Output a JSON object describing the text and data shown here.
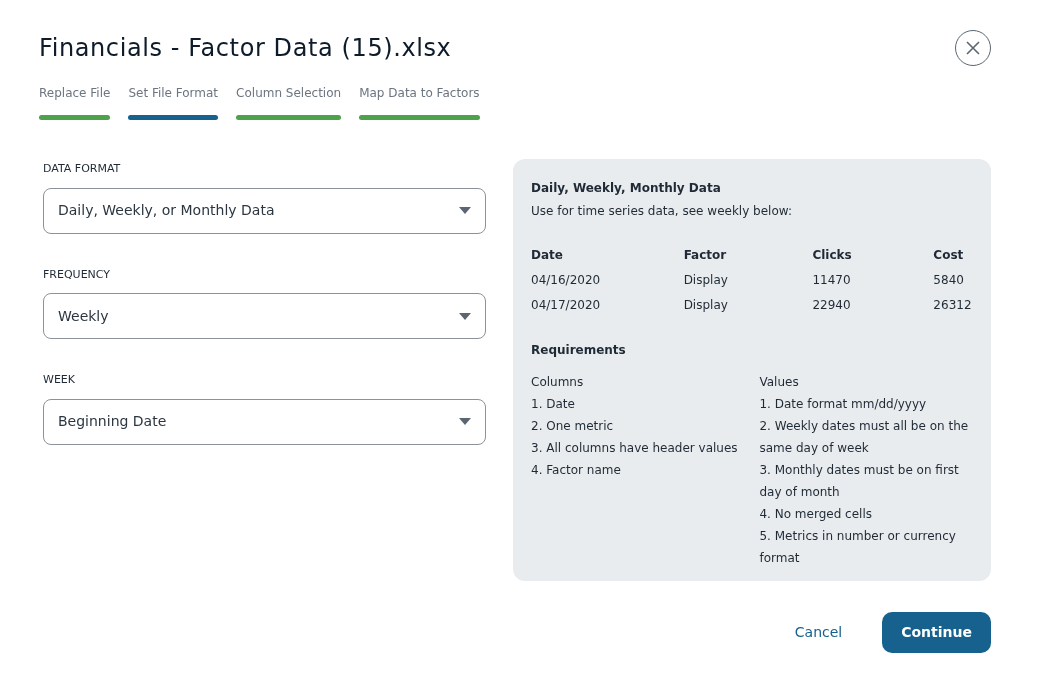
{
  "title": "Financials - Factor Data (15).xlsx",
  "steps": [
    {
      "label": "Replace File",
      "selected": false
    },
    {
      "label": "Set File Format",
      "selected": true
    },
    {
      "label": "Column Selection",
      "selected": false
    },
    {
      "label": "Map Data to Factors",
      "selected": false
    }
  ],
  "fields": [
    {
      "label": "DATA FORMAT",
      "value": "Daily, Weekly, or Monthly Data"
    },
    {
      "label": "FREQUENCY",
      "value": "Weekly"
    },
    {
      "label": "WEEK",
      "value": "Beginning Date"
    }
  ],
  "info": {
    "title": "Daily, Weekly, Monthly Data",
    "subtitle": "Use for time series data, see weekly below:",
    "table": {
      "columns": [
        "Date",
        "Factor",
        "Clicks",
        "Cost"
      ],
      "rows": [
        [
          "04/16/2020",
          "Display",
          "11470",
          "5840"
        ],
        [
          "04/17/2020",
          "Display",
          "22940",
          "26312"
        ]
      ]
    },
    "requirements_title": "Requirements",
    "columns_heading": "Columns",
    "columns_items": [
      "1. Date",
      "2. One metric",
      "3. All columns have header values",
      "4. Factor name"
    ],
    "values_heading": "Values",
    "values_items": [
      "1. Date format mm/dd/yyyy",
      "2. Weekly dates must all be on the same day of week",
      "3. Monthly dates must be on first day of month",
      "4. No merged cells",
      "5. Metrics in number or currency format"
    ]
  },
  "buttons": {
    "cancel": "Cancel",
    "continue": "Continue"
  }
}
